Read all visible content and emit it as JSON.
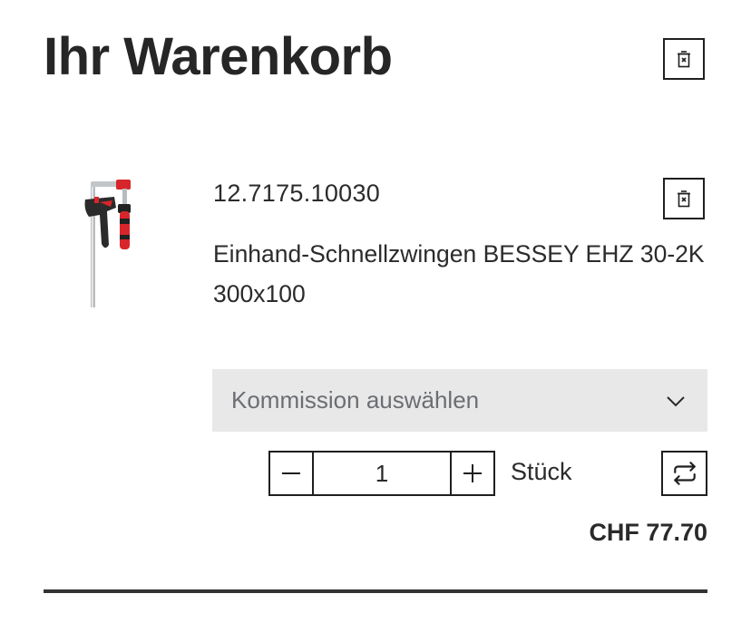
{
  "cart": {
    "title": "Ihr Warenkorb"
  },
  "item": {
    "article_number": "12.7175.10030",
    "name": "Einhand-Schnellzwingen BESSEY EHZ 30-2K 300x100",
    "commission": {
      "placeholder": "Kommission auswählen"
    },
    "quantity": "1",
    "unit": "Stück",
    "price": "CHF 77.70"
  },
  "icons": {
    "clear_cart": "delete-icon",
    "remove_item": "delete-icon",
    "dropdown": "chevron-down-icon",
    "decrease": "minus-icon",
    "increase": "plus-icon",
    "swap": "swap-icon"
  },
  "colors": {
    "text": "#2a2a2a",
    "border": "#1f1f1f",
    "select_bg": "#e8e8e8",
    "placeholder": "#6b6e72",
    "product_red": "#d7262b"
  }
}
